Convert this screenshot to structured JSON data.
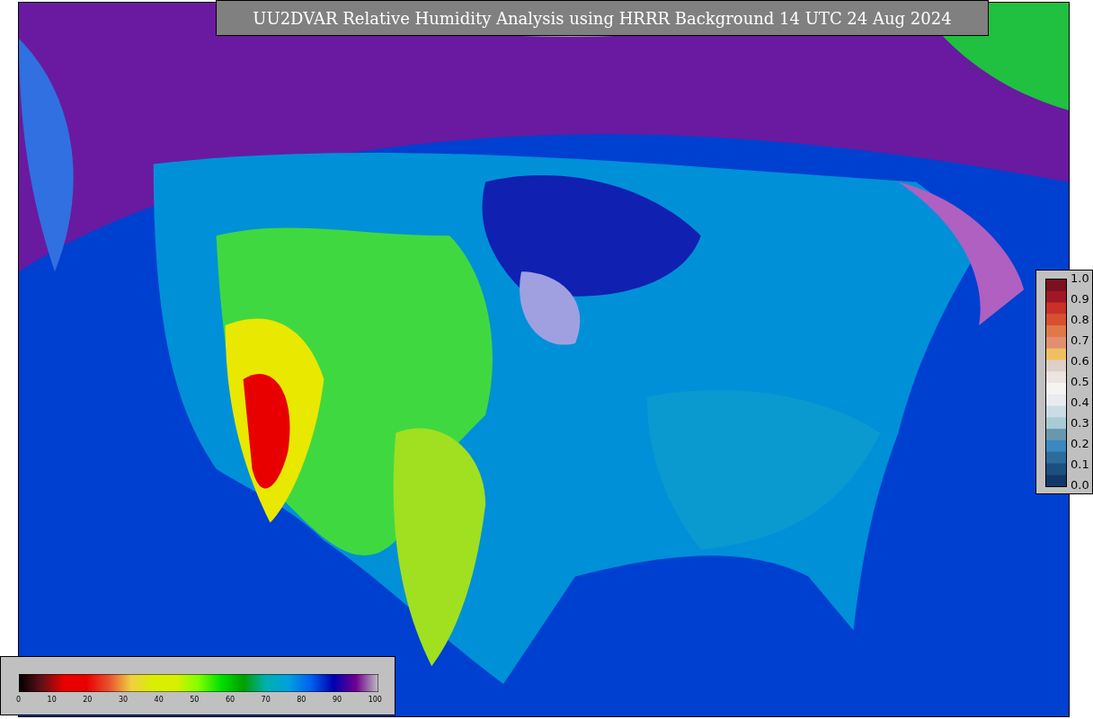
{
  "title": "UU2DVAR Relative Humidity Analysis using HRRR Background 14 UTC 24 Aug 2024",
  "humidity_colorbar": {
    "ticks": [
      "0",
      "10",
      "20",
      "30",
      "40",
      "50",
      "60",
      "70",
      "80",
      "90",
      "100"
    ]
  },
  "ratio_colorbar": {
    "ticks": [
      "1.0",
      "0.9",
      "0.8",
      "0.7",
      "0.6",
      "0.5",
      "0.4",
      "0.3",
      "0.2",
      "0.1",
      "0.0"
    ]
  }
}
